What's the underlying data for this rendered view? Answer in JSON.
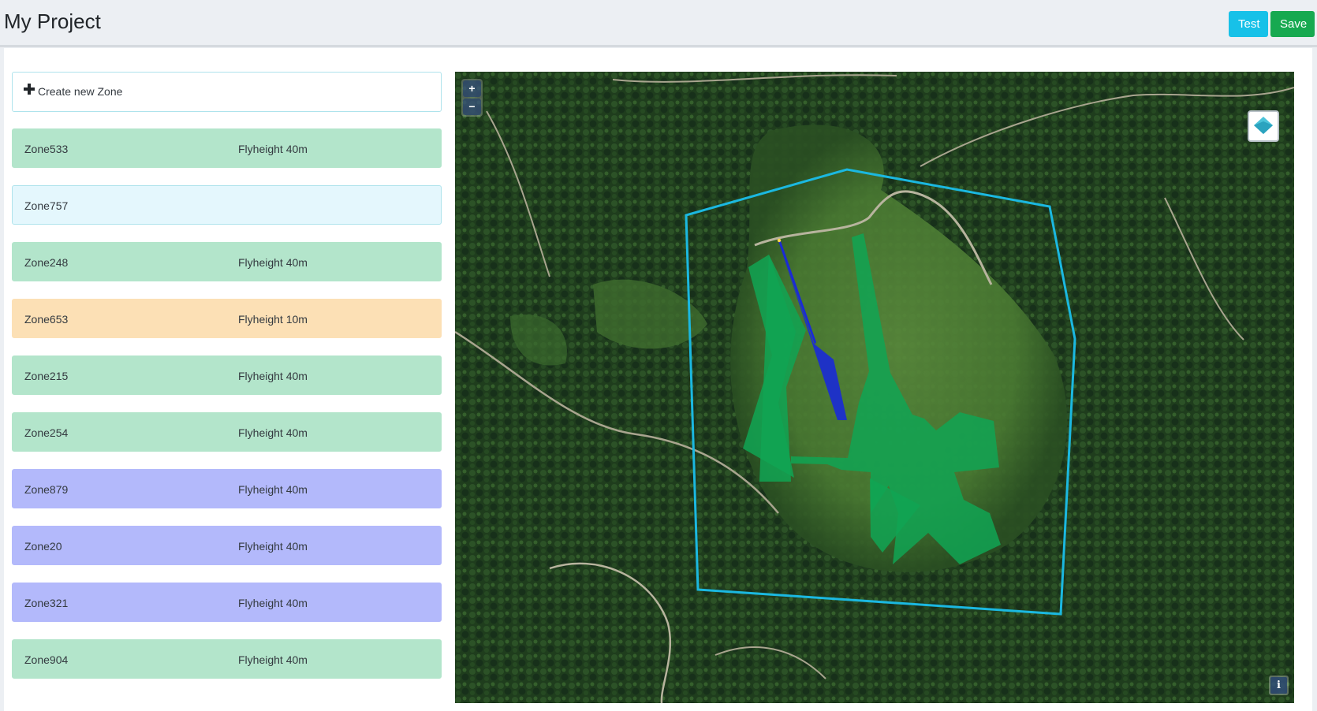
{
  "header": {
    "title": "My Project",
    "test_label": "Test",
    "save_label": "Save"
  },
  "zones": {
    "create_label": "Create new Zone",
    "items": [
      {
        "name": "Zone533",
        "flyheight": "Flyheight 40m",
        "color": "#b3e5cb"
      },
      {
        "name": "Zone757",
        "flyheight": "",
        "color": "#e4f7fd"
      },
      {
        "name": "Zone248",
        "flyheight": "Flyheight 40m",
        "color": "#b3e5cb"
      },
      {
        "name": "Zone653",
        "flyheight": "Flyheight 10m",
        "color": "#fce0b5"
      },
      {
        "name": "Zone215",
        "flyheight": "Flyheight 40m",
        "color": "#b3e5cb"
      },
      {
        "name": "Zone254",
        "flyheight": "Flyheight 40m",
        "color": "#b3e5cb"
      },
      {
        "name": "Zone879",
        "flyheight": "Flyheight 40m",
        "color": "#b3b9fb"
      },
      {
        "name": "Zone20",
        "flyheight": "Flyheight 40m",
        "color": "#b3b9fb"
      },
      {
        "name": "Zone321",
        "flyheight": "Flyheight 40m",
        "color": "#b3b9fb"
      },
      {
        "name": "Zone904",
        "flyheight": "Flyheight 40m",
        "color": "#b3e5cb"
      }
    ]
  },
  "map": {
    "zoom_in": "+",
    "zoom_out": "−",
    "info": "i",
    "boundary_color": "#1bb8e0",
    "zone_fill_color": "#10a454",
    "path_color": "#1a2ad6"
  }
}
